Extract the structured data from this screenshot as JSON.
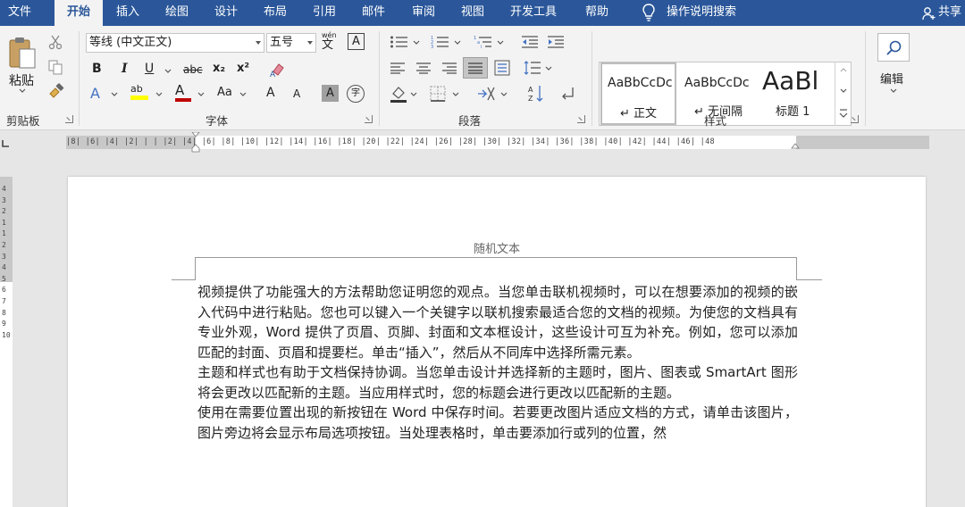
{
  "tabs": [
    {
      "label": "文件",
      "active": false
    },
    {
      "label": "开始",
      "active": true
    },
    {
      "label": "插入",
      "active": false
    },
    {
      "label": "绘图",
      "active": false
    },
    {
      "label": "设计",
      "active": false
    },
    {
      "label": "布局",
      "active": false
    },
    {
      "label": "引用",
      "active": false
    },
    {
      "label": "邮件",
      "active": false
    },
    {
      "label": "审阅",
      "active": false
    },
    {
      "label": "视图",
      "active": false
    },
    {
      "label": "开发工具",
      "active": false
    },
    {
      "label": "帮助",
      "active": false
    }
  ],
  "tell_me": {
    "label": "操作说明搜索",
    "icon": "lightbulb-icon"
  },
  "share": {
    "label": "共享",
    "icon": "person-add-icon"
  },
  "clipboard": {
    "paste_label": "粘贴",
    "group_label": "剪贴板",
    "icons": [
      "paste-icon",
      "cut-icon",
      "copy-icon",
      "format-painter-icon"
    ]
  },
  "font": {
    "family": "等线 (中文正文)",
    "size": "五号",
    "pinyin_glyph": "wén",
    "pinyin_char": "文",
    "border_char": "A",
    "bold": "B",
    "italic": "I",
    "underline": "U",
    "strike": "abc",
    "subscript": "x₂",
    "superscript": "x²",
    "text_effects": "A",
    "highlight": "ab",
    "font_color": "A",
    "change_case": "Aa",
    "grow": "A",
    "shrink": "A",
    "shading": "A",
    "enclose": "字",
    "group_label": "字体",
    "colors": {
      "highlight": "#ffff00",
      "font_color": "#c00000"
    }
  },
  "paragraph": {
    "group_label": "段落",
    "icons": [
      "bullets-icon",
      "numbering-icon",
      "multilevel-list-icon",
      "decrease-indent-icon",
      "increase-indent-icon",
      "align-left-icon",
      "align-center-icon",
      "align-right-icon",
      "justify-icon",
      "distributed-icon",
      "line-spacing-icon",
      "shading-icon",
      "borders-icon",
      "chinese-layout-icon",
      "sort-icon",
      "show-marks-icon"
    ]
  },
  "styles": {
    "group_label": "样式",
    "items": [
      {
        "sample": "AaBbCcDc",
        "name": "↵ 正文",
        "selected": true
      },
      {
        "sample": "AaBbCcDc",
        "name": "↵ 无间隔",
        "selected": false
      },
      {
        "sample": "AaBl",
        "name": "标题 1",
        "selected": false
      }
    ]
  },
  "editing": {
    "label": "编辑",
    "icon": "search-icon"
  },
  "ruler": {
    "h_labels": "|8| |6| |4| |2| | | |2| |4| |6| |8| |10| |12| |14| |16| |18| |20| |22| |24| |26| |28| |30| |32| |34| |36| |38| |40| |42| |44| |46| |48",
    "v_labels": [
      "4",
      "3",
      "2",
      "1",
      "",
      "1",
      "2",
      "3",
      "4",
      "5",
      "6",
      "7",
      "8",
      "9",
      "10"
    ]
  },
  "document": {
    "header": "随机文本",
    "paragraphs": [
      "视频提供了功能强大的方法帮助您证明您的观点。当您单击联机视频时，可以在想要添加的视频的嵌入代码中进行粘贴。您也可以键入一个关键字以联机搜索最适合您的文档的视频。为使您的文档具有专业外观，Word 提供了页眉、页脚、封面和文本框设计，这些设计可互为补充。例如，您可以添加匹配的封面、页眉和提要栏。单击“插入”，然后从不同库中选择所需元素。",
      "主题和样式也有助于文档保持协调。当您单击设计并选择新的主题时，图片、图表或 SmartArt 图形将会更改以匹配新的主题。当应用样式时，您的标题会进行更改以匹配新的主题。",
      "使用在需要位置出现的新按钮在 Word 中保存时间。若要更改图片适应文档的方式，请单击该图片，图片旁边将会显示布局选项按钮。当处理表格时，单击要添加行或列的位置，然"
    ]
  },
  "colors": {
    "brand": "#2b579a",
    "ribbon_bg": "#f3f3f3",
    "canvas_bg": "#e6e6e6"
  }
}
